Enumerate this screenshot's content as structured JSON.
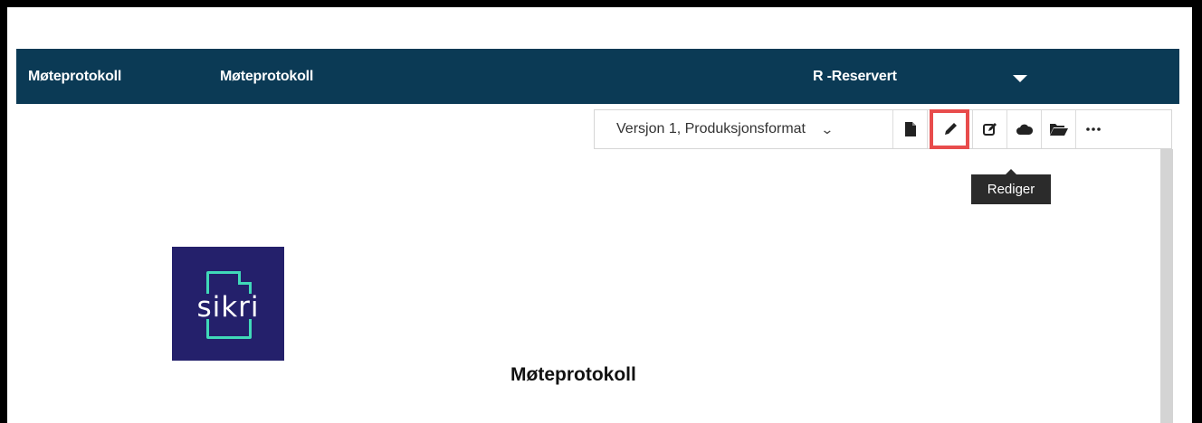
{
  "header": {
    "col1": "Møteprotokoll",
    "col2": "Møteprotokoll",
    "col3": "R -Reservert"
  },
  "toolbar": {
    "version_select": "Versjon 1, Produksjonsformat",
    "buttons": [
      "file-icon",
      "pencil-icon",
      "edit-box-icon",
      "cloud-icon",
      "folder-open-icon",
      "more-icon"
    ]
  },
  "tooltip": {
    "text": "Rediger"
  },
  "logo": {
    "text": "sikri"
  },
  "document": {
    "title": "Møteprotokoll"
  },
  "colors": {
    "header_bg": "#0b3a55",
    "highlight": "#e84c4c",
    "logo_bg": "#24206b",
    "logo_accent": "#40d9b9"
  }
}
